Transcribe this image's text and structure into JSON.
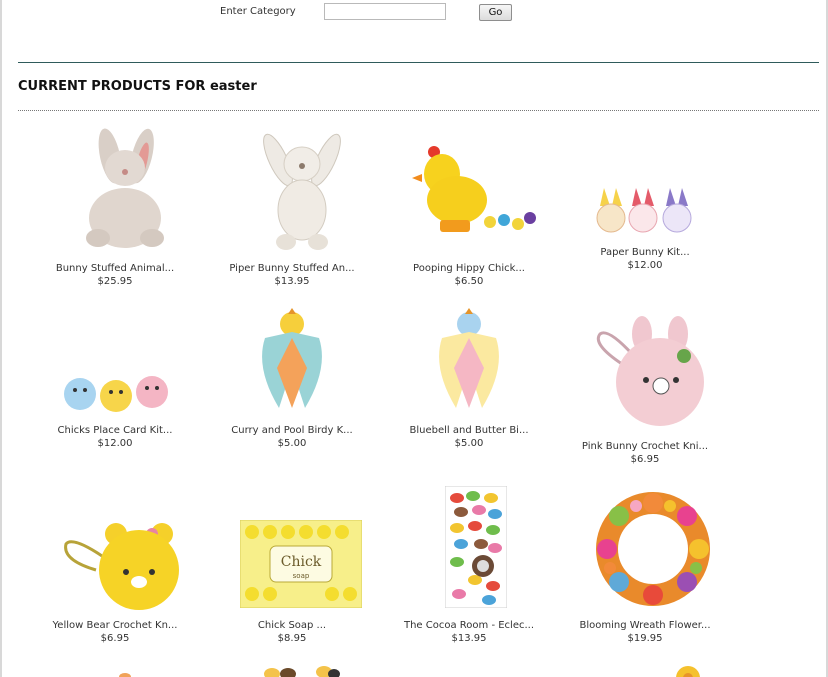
{
  "search": {
    "label": "Enter Category",
    "input_value": "",
    "button_label": "Go"
  },
  "heading": "CURRENT PRODUCTS FOR easter",
  "products": [
    {
      "name": "Bunny Stuffed Animal...",
      "price": "$25.95",
      "icon": "plush-bunny-image"
    },
    {
      "name": "Piper Bunny Stuffed An...",
      "price": "$13.95",
      "icon": "plush-bunny-image"
    },
    {
      "name": "Pooping Hippy Chick...",
      "price": "$6.50",
      "icon": "toy-chick-image"
    },
    {
      "name": "Paper Bunny Kit...",
      "price": "$12.00",
      "icon": "paper-bunny-image"
    },
    {
      "name": "Chicks Place Card Kit...",
      "price": "$12.00",
      "icon": "chick-cards-image"
    },
    {
      "name": "Curry and Pool Birdy K...",
      "price": "$5.00",
      "icon": "paper-bird-image"
    },
    {
      "name": "Bluebell and Butter Bi...",
      "price": "$5.00",
      "icon": "paper-bird-image"
    },
    {
      "name": "Pink Bunny Crochet Kni...",
      "price": "$6.95",
      "icon": "crochet-purse-image"
    },
    {
      "name": "Yellow Bear Crochet Kn...",
      "price": "$6.95",
      "icon": "crochet-purse-image"
    },
    {
      "name": "Chick Soap ...",
      "price": "$8.95",
      "icon": "soap-box-image"
    },
    {
      "name": "The Cocoa Room - Eclec...",
      "price": "$13.95",
      "icon": "candy-box-image"
    },
    {
      "name": "Blooming Wreath Flower...",
      "price": "$19.95",
      "icon": "flower-wreath-image"
    }
  ]
}
